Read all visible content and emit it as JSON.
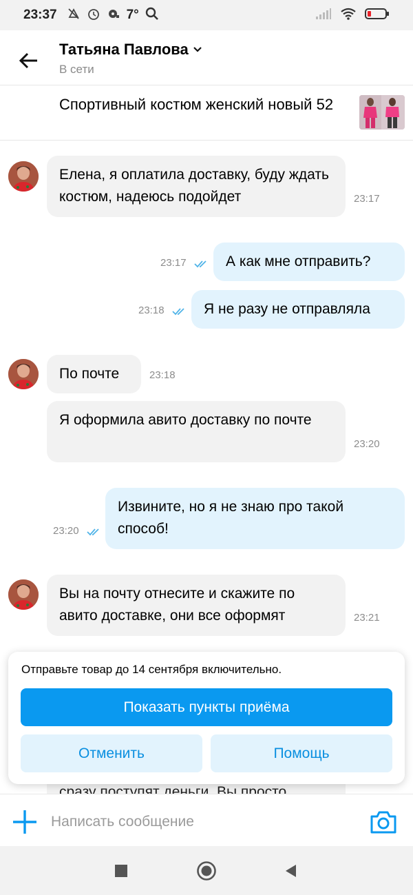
{
  "status_bar": {
    "time": "23:37",
    "temperature": "7°",
    "icons": [
      "mute-icon",
      "alarm-icon",
      "headset-icon",
      "search-icon",
      "signal-icon",
      "wifi-icon",
      "battery-icon"
    ]
  },
  "header": {
    "contact_name": "Татьяна Павлова",
    "status": "В сети"
  },
  "item": {
    "title": "Спортивный костюм женский новый 52"
  },
  "messages": [
    {
      "direction": "in",
      "text": "Елена, я оплатила доставку, буду ждать костюм, надеюсь подойдет",
      "time": "23:17"
    },
    {
      "direction": "out",
      "text": "А как мне отправить?",
      "time": "23:17"
    },
    {
      "direction": "out",
      "text": "Я не разу не отправляла",
      "time": "23:18"
    },
    {
      "direction": "in",
      "text": "По почте",
      "time": "23:18"
    },
    {
      "direction": "in",
      "text": "Я оформила авито доставку по почте",
      "time": "23:20"
    },
    {
      "direction": "out",
      "text": "Извините, но я не знаю про такой способ!",
      "time": "23:20"
    },
    {
      "direction": "in",
      "text": "Вы на почту отнесите и скажите по авито доставке, они все оформят",
      "time": "23:21"
    },
    {
      "direction": "in",
      "text": "сразу поступят деньги. Вы просто",
      "time": ""
    }
  ],
  "delivery_panel": {
    "notice": "Отправьте товар до 14 сентября включительно.",
    "primary_button": "Показать пункты приёма",
    "cancel_button": "Отменить",
    "help_button": "Помощь"
  },
  "composer": {
    "placeholder": "Написать сообщение"
  },
  "colors": {
    "accent": "#0A99F0",
    "incoming_bubble": "#F2F2F2",
    "outgoing_bubble": "#E2F3FD",
    "read_ticks": "#4FB3E8"
  }
}
